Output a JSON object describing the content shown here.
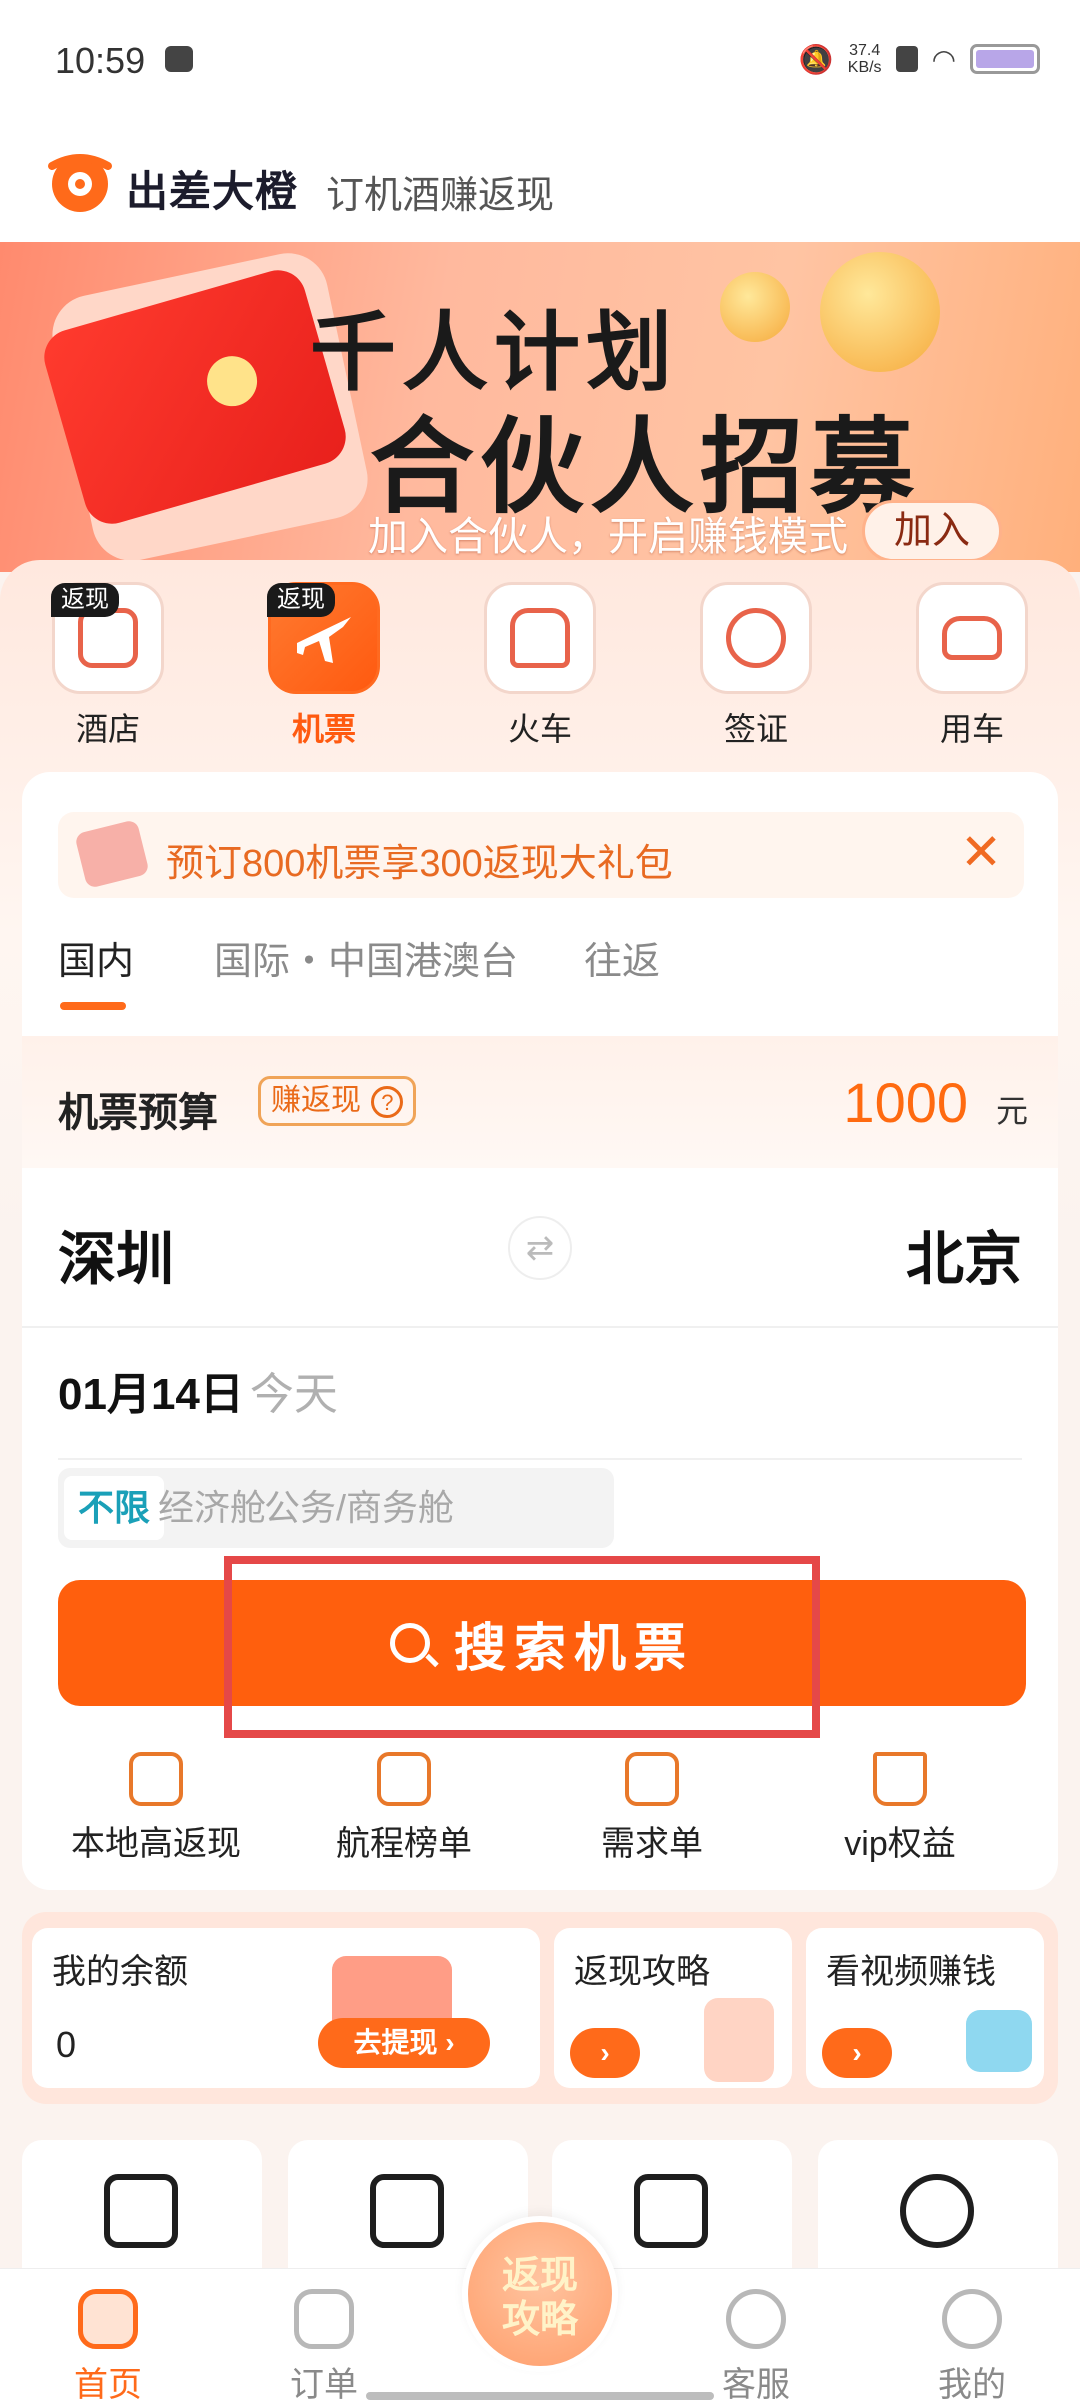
{
  "status_bar": {
    "time": "10:59",
    "net_speed_value": "37.4",
    "net_speed_unit": "KB/s"
  },
  "header": {
    "brand": "出差大橙",
    "slogan": "订机酒赚返现"
  },
  "banner": {
    "title_line1": "千人计划",
    "title_line2": "合伙人招募",
    "subtitle": "加入合伙人，开启赚钱模式",
    "join_button": "加入"
  },
  "categories": [
    {
      "label": "酒店",
      "badge": "返现",
      "icon": "hotel-icon",
      "active": false
    },
    {
      "label": "机票",
      "badge": "返现",
      "icon": "airplane-icon",
      "active": true
    },
    {
      "label": "火车",
      "badge": "",
      "icon": "train-icon",
      "active": false
    },
    {
      "label": "签证",
      "badge": "",
      "icon": "passport-icon",
      "active": false
    },
    {
      "label": "用车",
      "badge": "",
      "icon": "car-icon",
      "active": false
    }
  ],
  "promo": {
    "text": "预订800机票享300返现大礼包",
    "close": "✕"
  },
  "tabs": [
    {
      "label": "国内",
      "active": true
    },
    {
      "label": "国际・中国港澳台",
      "active": false
    },
    {
      "label": "往返",
      "active": false
    }
  ],
  "budget": {
    "label": "机票预算",
    "tag": "赚返现",
    "tag_icon": "?",
    "amount": "1000",
    "unit": "元"
  },
  "route": {
    "from": "深圳",
    "to": "北京",
    "swap_symbol": "⇄"
  },
  "date": {
    "date": "01月14日",
    "weekday": "今天"
  },
  "cabin": [
    {
      "label": "不限",
      "active": true
    },
    {
      "label": "经济舱",
      "active": false
    },
    {
      "label": "公务/商务舱",
      "active": false
    }
  ],
  "search_button": "搜索机票",
  "quick_links": [
    {
      "label": "本地高返现",
      "icon": "cashback-icon"
    },
    {
      "label": "航程榜单",
      "icon": "ranking-icon"
    },
    {
      "label": "需求单",
      "icon": "request-form-icon"
    },
    {
      "label": "vip权益",
      "icon": "vip-crown-icon"
    }
  ],
  "balance": {
    "title": "我的余额",
    "value": "0",
    "withdraw_button": "去提现 ›"
  },
  "cashback_guide": {
    "title": "返现攻略",
    "button": "›"
  },
  "video_earn": {
    "title": "看视频赚钱",
    "button": "›"
  },
  "bottom_nav": [
    {
      "label": "首页",
      "icon": "home-icon",
      "active": true
    },
    {
      "label": "订单",
      "icon": "order-icon",
      "active": false
    },
    {
      "label": "客服",
      "icon": "chat-icon",
      "active": false
    },
    {
      "label": "我的",
      "icon": "profile-icon",
      "active": false
    }
  ],
  "center_button": {
    "line1": "返现",
    "line2": "攻略"
  },
  "colors": {
    "accent": "#ff5f0d",
    "highlight_box": "#e54848",
    "cabin_active": "#1aa0b8"
  }
}
